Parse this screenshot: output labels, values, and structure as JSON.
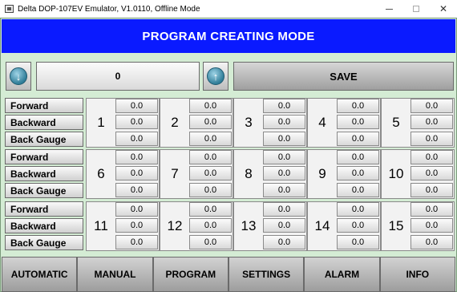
{
  "window": {
    "title": "Delta DOP-107EV Emulator, V1.0110, Offline Mode",
    "minimize_label": "—",
    "maximize_label": "☐",
    "close_label": "✕"
  },
  "header": {
    "title": "PROGRAM CREATING MODE"
  },
  "toolbar": {
    "down_icon": "arrow-down-icon",
    "up_icon": "arrow-up-icon",
    "program_value": "0",
    "save_label": "SAVE"
  },
  "colors": {
    "header": "#0a1aff",
    "background": "#d4ecd4"
  },
  "rows": [
    {
      "labels": [
        "Forward",
        "Backward",
        "Back Gauge"
      ],
      "programs": [
        {
          "number": "1",
          "values": [
            "0.0",
            "0.0",
            "0.0"
          ]
        },
        {
          "number": "2",
          "values": [
            "0.0",
            "0.0",
            "0.0"
          ]
        },
        {
          "number": "3",
          "values": [
            "0.0",
            "0.0",
            "0.0"
          ]
        },
        {
          "number": "4",
          "values": [
            "0.0",
            "0.0",
            "0.0"
          ]
        },
        {
          "number": "5",
          "values": [
            "0.0",
            "0.0",
            "0.0"
          ]
        }
      ]
    },
    {
      "labels": [
        "Forward",
        "Backward",
        "Back Gauge"
      ],
      "programs": [
        {
          "number": "6",
          "values": [
            "0.0",
            "0.0",
            "0.0"
          ]
        },
        {
          "number": "7",
          "values": [
            "0.0",
            "0.0",
            "0.0"
          ]
        },
        {
          "number": "8",
          "values": [
            "0.0",
            "0.0",
            "0.0"
          ]
        },
        {
          "number": "9",
          "values": [
            "0.0",
            "0.0",
            "0.0"
          ]
        },
        {
          "number": "10",
          "values": [
            "0.0",
            "0.0",
            "0.0"
          ]
        }
      ]
    },
    {
      "labels": [
        "Forward",
        "Backward",
        "Back Gauge"
      ],
      "programs": [
        {
          "number": "11",
          "values": [
            "0.0",
            "0.0",
            "0.0"
          ]
        },
        {
          "number": "12",
          "values": [
            "0.0",
            "0.0",
            "0.0"
          ]
        },
        {
          "number": "13",
          "values": [
            "0.0",
            "0.0",
            "0.0"
          ]
        },
        {
          "number": "14",
          "values": [
            "0.0",
            "0.0",
            "0.0"
          ]
        },
        {
          "number": "15",
          "values": [
            "0.0",
            "0.0",
            "0.0"
          ]
        }
      ]
    }
  ],
  "nav": [
    "AUTOMATIC",
    "MANUAL",
    "PROGRAM",
    "SETTINGS",
    "ALARM",
    "INFO"
  ]
}
